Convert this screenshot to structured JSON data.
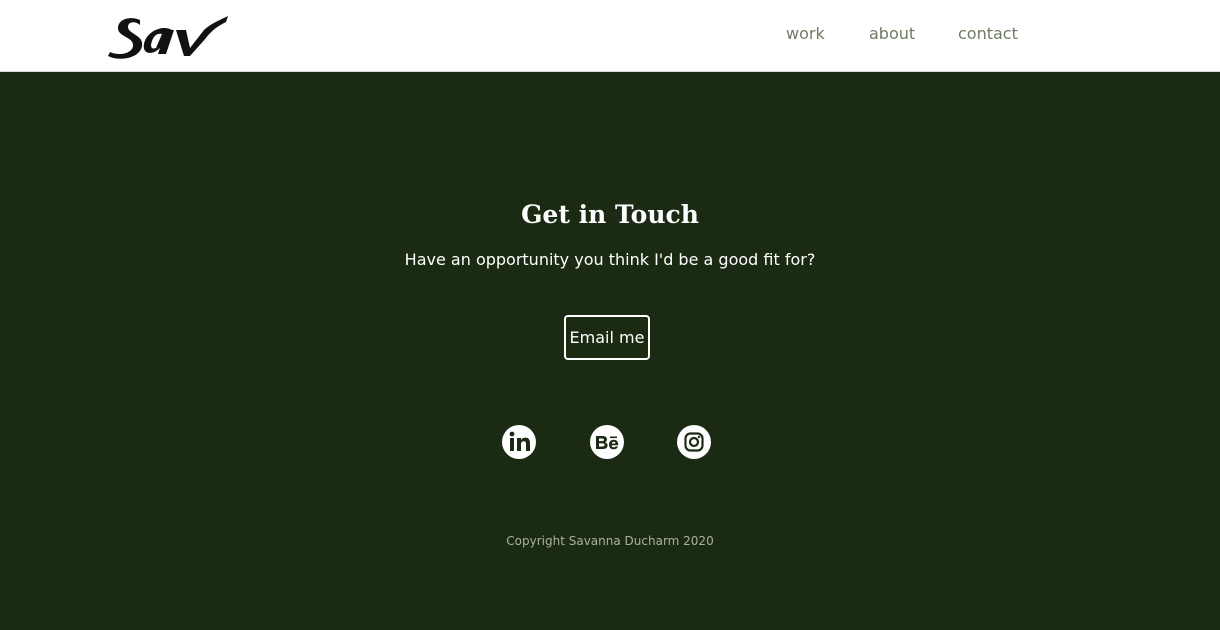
{
  "header": {
    "logo_text": "sav",
    "nav": [
      {
        "label": "work"
      },
      {
        "label": "about"
      },
      {
        "label": "contact"
      }
    ]
  },
  "contact_section": {
    "heading": "Get in Touch",
    "subtitle": "Have an opportunity you think I'd be a good fit for?",
    "email_button_label": "Email me",
    "social_icons": [
      "linkedin-icon",
      "behance-icon",
      "instagram-icon"
    ]
  },
  "footer": {
    "copyright": "Copyright Savanna Ducharm 2020"
  },
  "colors": {
    "background": "#1b2a12",
    "header_background": "#ffffff",
    "nav_text": "#6f7a63",
    "text": "#ffffff"
  }
}
